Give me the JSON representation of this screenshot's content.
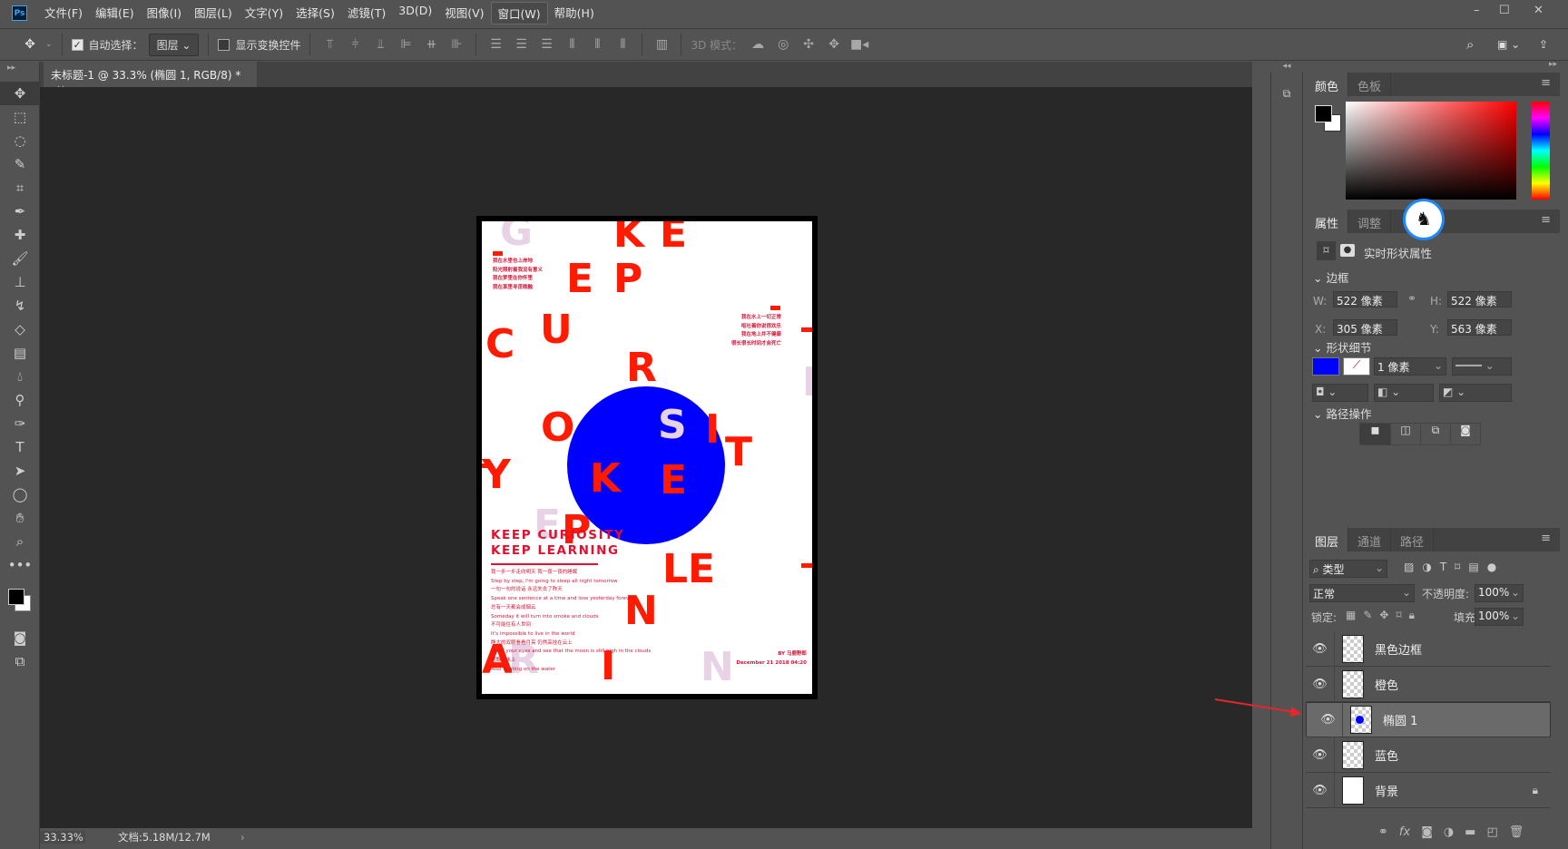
{
  "app": {
    "logo": "Ps",
    "menu": [
      "文件(F)",
      "编辑(E)",
      "图像(I)",
      "图层(L)",
      "文字(Y)",
      "选择(S)",
      "滤镜(T)",
      "3D(D)",
      "视图(V)",
      "窗口(W)",
      "帮助(H)"
    ],
    "active_menu": "窗口(W)"
  },
  "options": {
    "auto_select_label": "自动选择：",
    "auto_select_checked": true,
    "auto_select_value": "图层",
    "show_transform_label": "显示变换控件",
    "show_transform_checked": false,
    "mode_3d_label": "3D 模式："
  },
  "document": {
    "tab_title": "未标题-1 @ 33.3% (椭圆 1, RGB/8) *",
    "close": "×"
  },
  "tools": [
    "move-icon",
    "marquee-icon",
    "lasso-icon",
    "quick-select-icon",
    "crop-icon",
    "eyedropper-icon",
    "healing-icon",
    "brush-icon",
    "stamp-icon",
    "history-brush-icon",
    "eraser-icon",
    "gradient-icon",
    "blur-icon",
    "dodge-icon",
    "pen-icon",
    "type-icon",
    "path-select-icon",
    "ellipse-icon",
    "hand-icon",
    "zoom-icon",
    "more-icon"
  ],
  "poster": {
    "letters": [
      "G",
      "K",
      "E",
      "E",
      "P",
      "C",
      "U",
      "R",
      "I",
      "S",
      "O",
      "I",
      "T",
      "Y",
      "K",
      "E",
      "E",
      "P",
      "LE",
      "N",
      "A",
      "R",
      "I",
      "N"
    ],
    "headline": [
      "KEEP CURIOSITY",
      "KEEP LEARNING"
    ],
    "top_left": [
      "我在水里也上岸地",
      "阳光照射着我没有意义",
      "我在梦里在你怀里",
      "我在某里寻觅晚融"
    ],
    "top_right": [
      "我在水上一切正常",
      "呕吐着你说很欢乐",
      "我在地上并不健康",
      "很长很长时间才会死亡"
    ],
    "body": [
      "我一步一步走向明天 我一夜一夜的睡眠",
      "Step by step, I'm going to sleep all night tomorrow",
      "一句一句的说话 永远失去了昨天",
      "Speak one sentence at a time and lose yesterday forever",
      "总有一天都会成烟云",
      "Someday it will turn into smoke and clouds",
      "不可能住有人世间",
      "It's impossible to live in the world",
      "睁大的双眼看看月亮 仍然高挂在云上",
      "Open your eyes and see that the moon is still high in the clouds",
      "也飘在水上",
      "Also floating on the water"
    ],
    "byline": "BY 马鹿野郎",
    "date": "December 21 2018 04:20",
    "colors": {
      "red": "#ff1a00",
      "pink": "#e8d3e6",
      "circle": "#0000ff"
    }
  },
  "status": {
    "zoom": "33.33%",
    "doc": "文档:5.18M/12.7M"
  },
  "color_panel": {
    "tabs": [
      "颜色",
      "色板"
    ]
  },
  "properties": {
    "tabs": [
      "属性",
      "调整"
    ],
    "title": "实时形状属性",
    "section_bounds": "边框",
    "w_label": "W:",
    "w": "522 像素",
    "h_label": "H:",
    "h": "522 像素",
    "x_label": "X:",
    "x": "305 像素",
    "y_label": "Y:",
    "y": "563 像素",
    "section_shape": "形状细节",
    "fill_color": "#0000ff",
    "stroke_width": "1 像素",
    "section_path": "路径操作"
  },
  "layers": {
    "tabs": [
      "图层",
      "通道",
      "路径"
    ],
    "filter": "类型",
    "blend": "正常",
    "opacity_label": "不透明度:",
    "opacity": "100%",
    "lock_label": "锁定:",
    "fill_label": "填充:",
    "fill": "100%",
    "items": [
      {
        "name": "黑色边框"
      },
      {
        "name": "橙色"
      },
      {
        "name": "椭圆 1",
        "selected": true
      },
      {
        "name": "蓝色"
      },
      {
        "name": "背景",
        "locked": true
      }
    ]
  }
}
